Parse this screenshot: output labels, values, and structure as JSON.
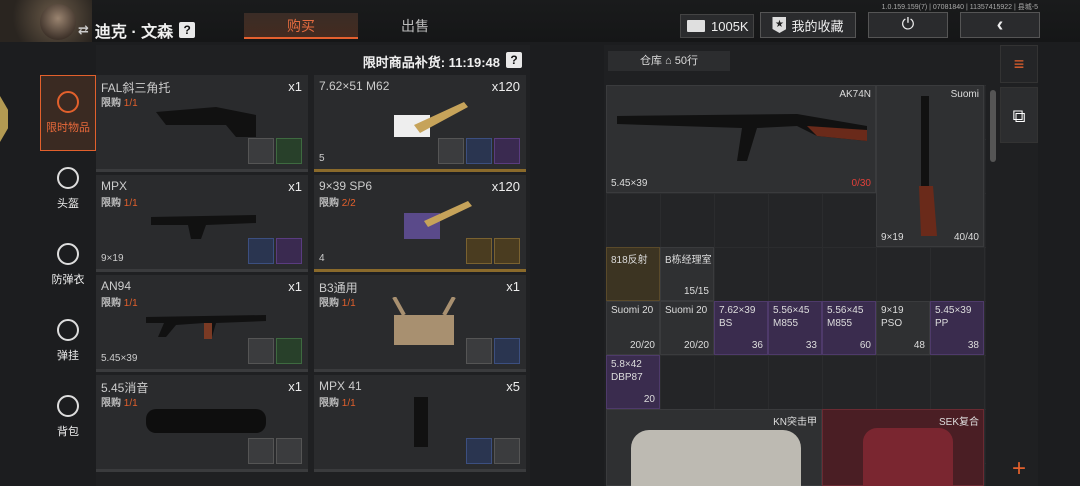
{
  "header": {
    "player_name": "迪克 · 文森",
    "help": "?",
    "tabs": [
      {
        "label": "购买",
        "active": true
      },
      {
        "label": "出售",
        "active": false
      }
    ],
    "version": "1.0.159.159(7) | 07081840 | 11357415922 | 县城-5",
    "currency_amount": "1005K",
    "favorites_label": "我的收藏"
  },
  "categories": [
    {
      "label": "限时物品",
      "icon": "clock-icon",
      "active": true
    },
    {
      "label": "头盔",
      "icon": "helmet-icon",
      "active": false
    },
    {
      "label": "防弹衣",
      "icon": "vest-icon",
      "active": false
    },
    {
      "label": "弹挂",
      "icon": "chest-rig-icon",
      "active": false
    },
    {
      "label": "背包",
      "icon": "backpack-icon",
      "active": false
    }
  ],
  "shop": {
    "restock_label": "限时商品补货: 11:19:48",
    "items": [
      {
        "name": "FAL斜三角托",
        "limit_label": "限购",
        "limit": "1/1",
        "qty": "x1",
        "sub": ""
      },
      {
        "name": "7.62×51 M62",
        "limit_label": "",
        "limit": "",
        "qty": "x120",
        "sub": "5"
      },
      {
        "name": "MPX",
        "limit_label": "限购",
        "limit": "1/1",
        "qty": "x1",
        "sub": "9×19"
      },
      {
        "name": "9×39 SP6",
        "limit_label": "限购",
        "limit": "2/2",
        "qty": "x120",
        "sub": "4"
      },
      {
        "name": "AN94",
        "limit_label": "限购",
        "limit": "1/1",
        "qty": "x1",
        "sub": "5.45×39"
      },
      {
        "name": "B3通用",
        "limit_label": "限购",
        "limit": "1/1",
        "qty": "x1",
        "sub": ""
      },
      {
        "name": "5.45消音",
        "limit_label": "限购",
        "limit": "1/1",
        "qty": "x1",
        "sub": ""
      },
      {
        "name": "MPX 41",
        "limit_label": "限购",
        "limit": "1/1",
        "qty": "x5",
        "sub": ""
      }
    ]
  },
  "warehouse": {
    "label": "仓库",
    "rows": "50行",
    "items": [
      {
        "name": "AK74N",
        "caliber": "5.45×39",
        "ammo": "0/30"
      },
      {
        "name": "Suomi",
        "caliber": "9×19",
        "ammo": "40/40"
      },
      {
        "name": "818反射",
        "caliber": "",
        "ammo": ""
      },
      {
        "name": "B栋经理室",
        "caliber": "",
        "ammo": "15/15"
      },
      {
        "name": "Suomi 20",
        "caliber": "",
        "ammo": "20/20"
      },
      {
        "name": "Suomi 20",
        "caliber": "",
        "ammo": "20/20"
      },
      {
        "name": "7.62×39",
        "caliber": "BS",
        "ammo": "36"
      },
      {
        "name": "5.56×45",
        "caliber": "M855",
        "ammo": "33"
      },
      {
        "name": "5.56×45",
        "caliber": "M855",
        "ammo": "60"
      },
      {
        "name": "9×19",
        "caliber": "PSO",
        "ammo": "48"
      },
      {
        "name": "5.45×39",
        "caliber": "PP",
        "ammo": "38"
      },
      {
        "name": "5.8×42",
        "caliber": "DBP87",
        "ammo": "20"
      },
      {
        "name": "KN突击甲",
        "caliber": "",
        "ammo": ""
      },
      {
        "name": "SEK复合",
        "caliber": "",
        "ammo": ""
      }
    ]
  }
}
